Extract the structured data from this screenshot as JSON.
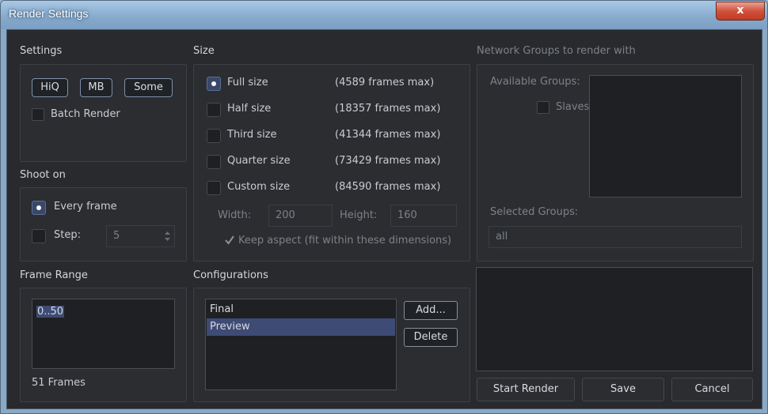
{
  "window": {
    "title": "Render Settings",
    "close_glyph": "x"
  },
  "settings": {
    "heading": "Settings",
    "toggles": [
      "HiQ",
      "MB",
      "Some"
    ],
    "batch_render_label": "Batch Render",
    "batch_render_checked": false
  },
  "shoot_on": {
    "heading": "Shoot on",
    "every_frame_label": "Every frame",
    "every_frame_selected": true,
    "step_label": "Step:",
    "step_value": "5"
  },
  "frame_range": {
    "heading": "Frame Range",
    "value": "0..50",
    "frames_count": "51 Frames"
  },
  "size": {
    "heading": "Size",
    "options": [
      {
        "label": "Full size",
        "frames": "(4589 frames max)",
        "selected": true
      },
      {
        "label": "Half size",
        "frames": "(18357 frames max)",
        "selected": false
      },
      {
        "label": "Third size",
        "frames": "(41344 frames max)",
        "selected": false
      },
      {
        "label": "Quarter size",
        "frames": "(73429 frames max)",
        "selected": false
      },
      {
        "label": "Custom size",
        "frames": "(84590 frames max)",
        "selected": false
      }
    ],
    "width_label": "Width:",
    "width_value": "200",
    "height_label": "Height:",
    "height_value": "160",
    "keep_aspect_label": "Keep aspect (fit within these dimensions)",
    "keep_aspect_checked": true
  },
  "configurations": {
    "heading": "Configurations",
    "items": [
      "Final",
      "Preview"
    ],
    "selected_index": 1,
    "add_label": "Add...",
    "delete_label": "Delete"
  },
  "network": {
    "heading": "Network Groups to render with",
    "available_label": "Available Groups:",
    "slaves_label": "Slaves",
    "slaves_checked": false,
    "selected_label": "Selected Groups:",
    "selected_value": "all"
  },
  "actions": {
    "start_render_label": "Start Render",
    "save_label": "Save",
    "cancel_label": "Cancel"
  },
  "icons": {
    "close": "close-icon",
    "spin": "spin-arrows-icon",
    "check": "checkmark-icon"
  },
  "colors": {
    "background": "#282a2e",
    "selection": "#3e4b75",
    "radio_on": "#394869",
    "close_button": "#c94a33"
  }
}
